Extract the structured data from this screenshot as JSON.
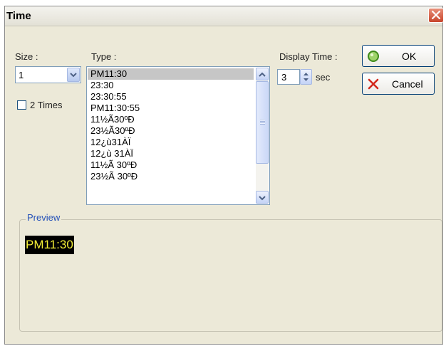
{
  "window": {
    "title": "Time"
  },
  "size": {
    "label": "Size :",
    "value": "1",
    "double_label": "2 Times",
    "double_checked": false
  },
  "type": {
    "label": "Type :",
    "items": [
      "PM11:30",
      "23:30",
      "23:30:55",
      "PM11:30:55",
      "11½Ã30ºÐ",
      "23½Ã30ºÐ",
      "12¿ù31ÀÏ",
      "12¿ù 31ÀÏ",
      "11½Ã 30ºÐ",
      "23½Ã 30ºÐ"
    ],
    "selected_index": 0
  },
  "display_time": {
    "label": "Display Time :",
    "value": "3",
    "unit": "sec"
  },
  "buttons": {
    "ok": "OK",
    "cancel": "Cancel"
  },
  "preview": {
    "label": "Preview",
    "text": "PM11:30"
  },
  "colors": {
    "dialog_bg": "#ece9d8",
    "preview_bg": "#000000",
    "preview_fg": "#f4ef36",
    "legend_fg": "#2552b8",
    "selection_bg": "#c6c6c6"
  },
  "icons": {
    "close": "close-x-icon",
    "ok": "green-circle-icon",
    "cancel": "red-x-icon"
  }
}
